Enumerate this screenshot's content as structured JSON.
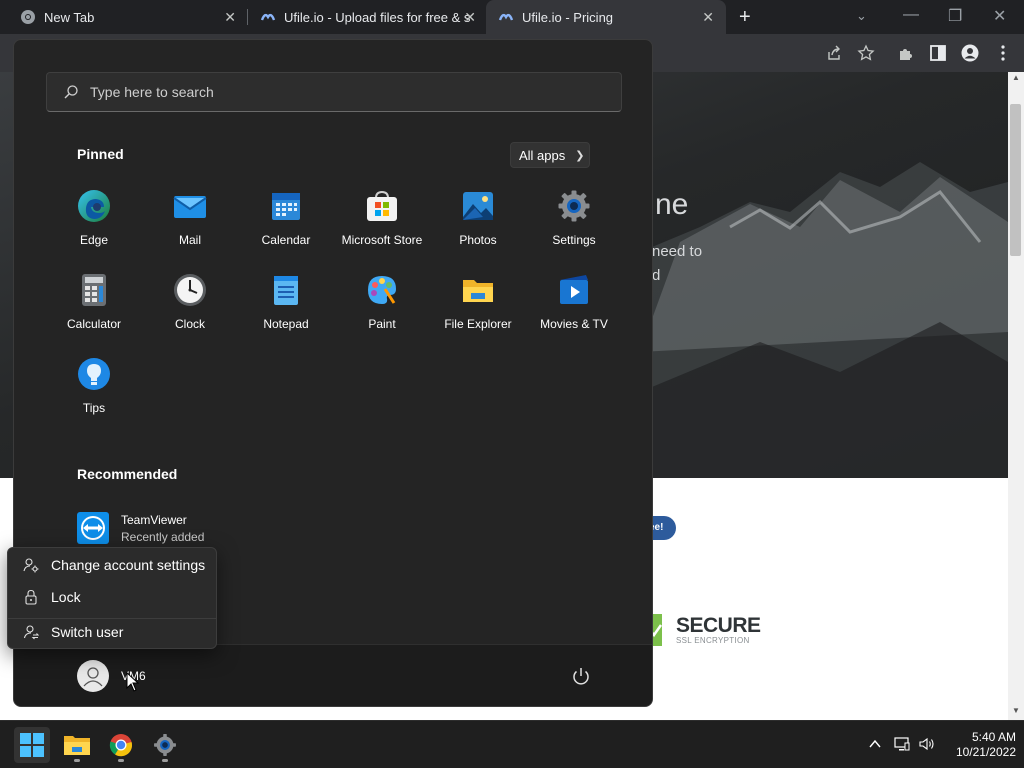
{
  "browser": {
    "tabs": [
      {
        "title": "New Tab",
        "active": false
      },
      {
        "title": "Ufile.io - Upload files for free & s",
        "active": false
      },
      {
        "title": "Ufile.io - Pricing",
        "active": true
      }
    ]
  },
  "webpage": {
    "hero_heading_fragment": "ne",
    "hero_text_line1": "need to",
    "hero_text_line2": "d",
    "badge_fragment": "ee!",
    "secure_title": "SECURE",
    "secure_subtitle": "SSL ENCRYPTION"
  },
  "start_menu": {
    "search_placeholder": "Type here to search",
    "pinned_title": "Pinned",
    "all_apps_label": "All apps",
    "pinned_apps": [
      {
        "label": "Edge",
        "icon": "edge-icon"
      },
      {
        "label": "Mail",
        "icon": "mail-icon"
      },
      {
        "label": "Calendar",
        "icon": "calendar-icon"
      },
      {
        "label": "Microsoft Store",
        "icon": "store-icon"
      },
      {
        "label": "Photos",
        "icon": "photos-icon"
      },
      {
        "label": "Settings",
        "icon": "settings-icon"
      },
      {
        "label": "Calculator",
        "icon": "calculator-icon"
      },
      {
        "label": "Clock",
        "icon": "clock-icon"
      },
      {
        "label": "Notepad",
        "icon": "notepad-icon"
      },
      {
        "label": "Paint",
        "icon": "paint-icon"
      },
      {
        "label": "File Explorer",
        "icon": "folder-icon"
      },
      {
        "label": "Movies & TV",
        "icon": "movies-icon"
      },
      {
        "label": "Tips",
        "icon": "tips-icon"
      }
    ],
    "recommended_title": "Recommended",
    "recommended": [
      {
        "name": "TeamViewer",
        "subtitle": "Recently added"
      }
    ],
    "user_name": "VM6"
  },
  "account_flyout": {
    "items": [
      {
        "label": "Change account settings",
        "icon": "account-settings-icon"
      },
      {
        "label": "Lock",
        "icon": "lock-icon"
      },
      {
        "label": "Switch user",
        "icon": "switch-user-icon"
      }
    ]
  },
  "taskbar": {
    "time": "5:40 AM",
    "date": "10/21/2022"
  },
  "colors": {
    "start_menu_bg": "#242424",
    "taskbar_bg": "#1f1f1f",
    "accent": "#2b88d8"
  }
}
